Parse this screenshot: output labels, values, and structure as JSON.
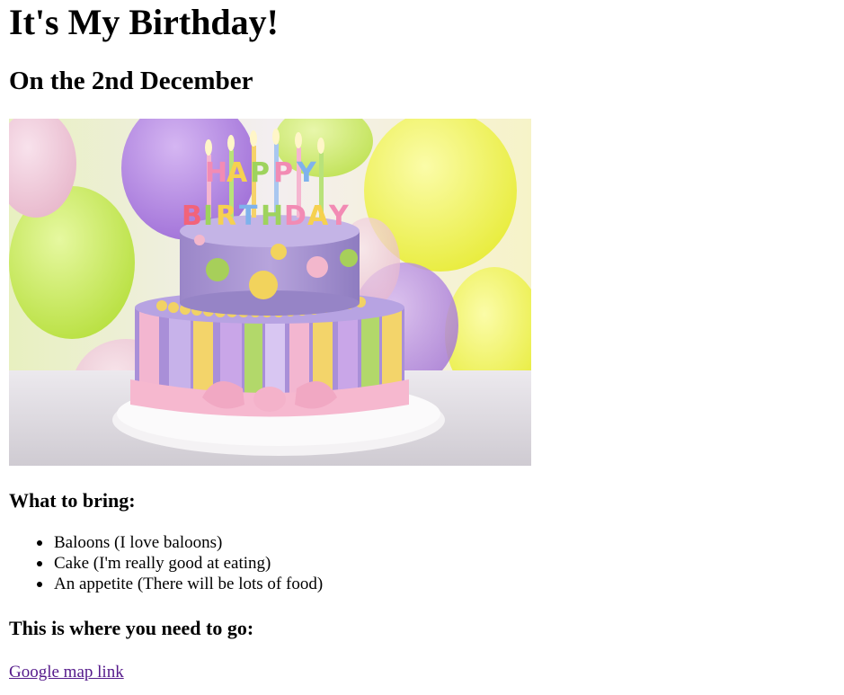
{
  "page": {
    "title": "It's My Birthday!",
    "subtitle": "On the 2nd December"
  },
  "image": {
    "description_icon": "birthday-cake-image",
    "candle_letters": "HAPPY BIRTHDAY"
  },
  "bring": {
    "heading": "What to bring:",
    "items": [
      "Baloons (I love baloons)",
      "Cake (I'm really good at eating)",
      "An appetite (There will be lots of food)"
    ]
  },
  "directions": {
    "heading": "This is where you need to go:",
    "link_label": "Google map link"
  },
  "colors": {
    "text": "#000000",
    "visited_link": "#551a8b",
    "background": "#ffffff"
  }
}
